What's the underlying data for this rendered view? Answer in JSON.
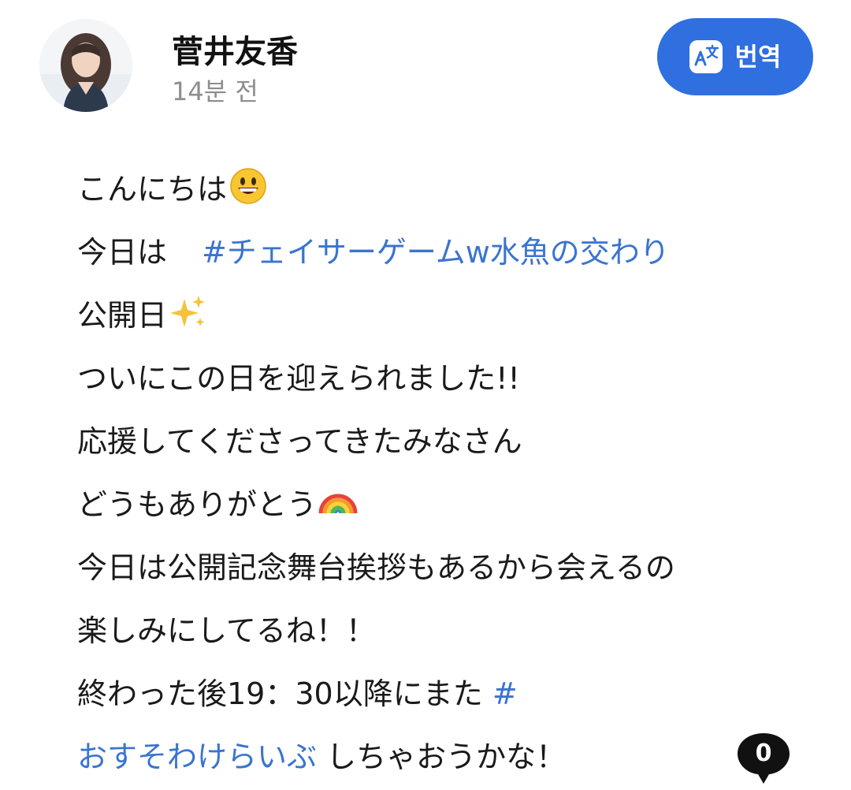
{
  "post": {
    "author": "菅井友香",
    "time_ago": "14분 전",
    "translate_label": "번역",
    "avatar_icon": "profile-photo",
    "body": {
      "l1": "こんにちは",
      "l2_text": "今日は",
      "l2_tag": "#チェイサーゲームw水魚の交わり",
      "l3": "公開日",
      "l4": "ついにこの日を迎えられました!!",
      "l5": "応援してくださってきたみなさん",
      "l6": "どうもありがとう",
      "l7": "今日は公開記念舞台挨拶もあるから会えるの",
      "l8": "楽しみにしてるね！！",
      "l9_text": "終わった後19：30以降にまた",
      "l9_tag": "#",
      "l10_tag": "おすそわけらいぶ",
      "l10_text": "しちゃおうかな！"
    },
    "emojis": {
      "smile": "grinning-face-emoji",
      "sparkles": "sparkles-emoji",
      "rainbow": "rainbow-emoji"
    },
    "comment_count": "0"
  },
  "colors": {
    "accent": "#2f6fe0",
    "hashtag": "#3a74d0",
    "muted_text": "#8e8e8e",
    "badge": "#111111"
  }
}
